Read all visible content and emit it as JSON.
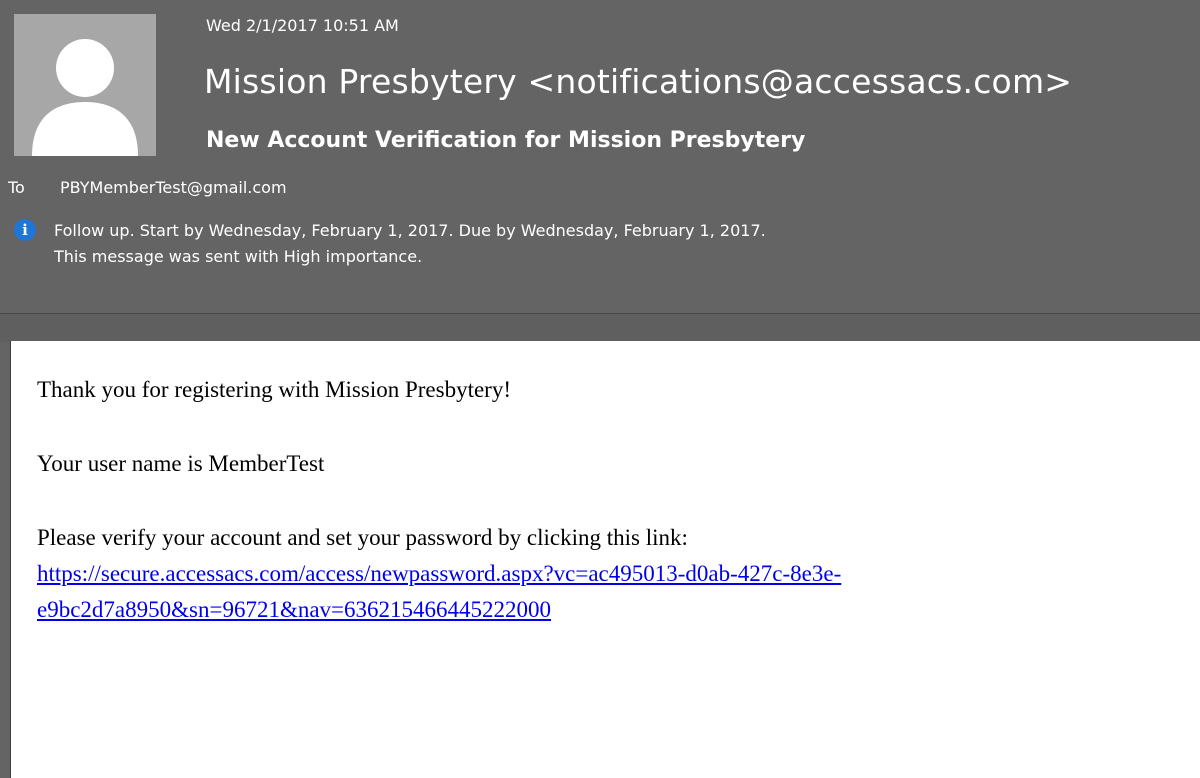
{
  "header": {
    "date": "Wed 2/1/2017 10:51 AM",
    "sender": "Mission Presbytery <notifications@accessacs.com>",
    "subject": "New Account Verification for Mission Presbytery",
    "to_label": "To",
    "to_address": "PBYMemberTest@gmail.com",
    "info_icon": "info-icon",
    "info_line_1": "Follow up.  Start by Wednesday, February 1, 2017.  Due by Wednesday, February 1, 2017.",
    "info_line_2": "This message was sent with High importance."
  },
  "body": {
    "thanks": "Thank you for registering with Mission Presbytery!",
    "username_line": "Your user name is MemberTest",
    "verify_line": "Please verify your account and set your password by clicking this link:",
    "link_line_1": "https://secure.accessacs.com/access/newpassword.aspx?vc=ac495013-d0ab-427c-8e3e-",
    "link_line_2": "e9bc2d7a8950&sn=96721&nav=636215466445222000"
  },
  "colors": {
    "header_bg": "#646464",
    "info_blue": "#1e76d6",
    "link_blue": "#0000ee"
  }
}
